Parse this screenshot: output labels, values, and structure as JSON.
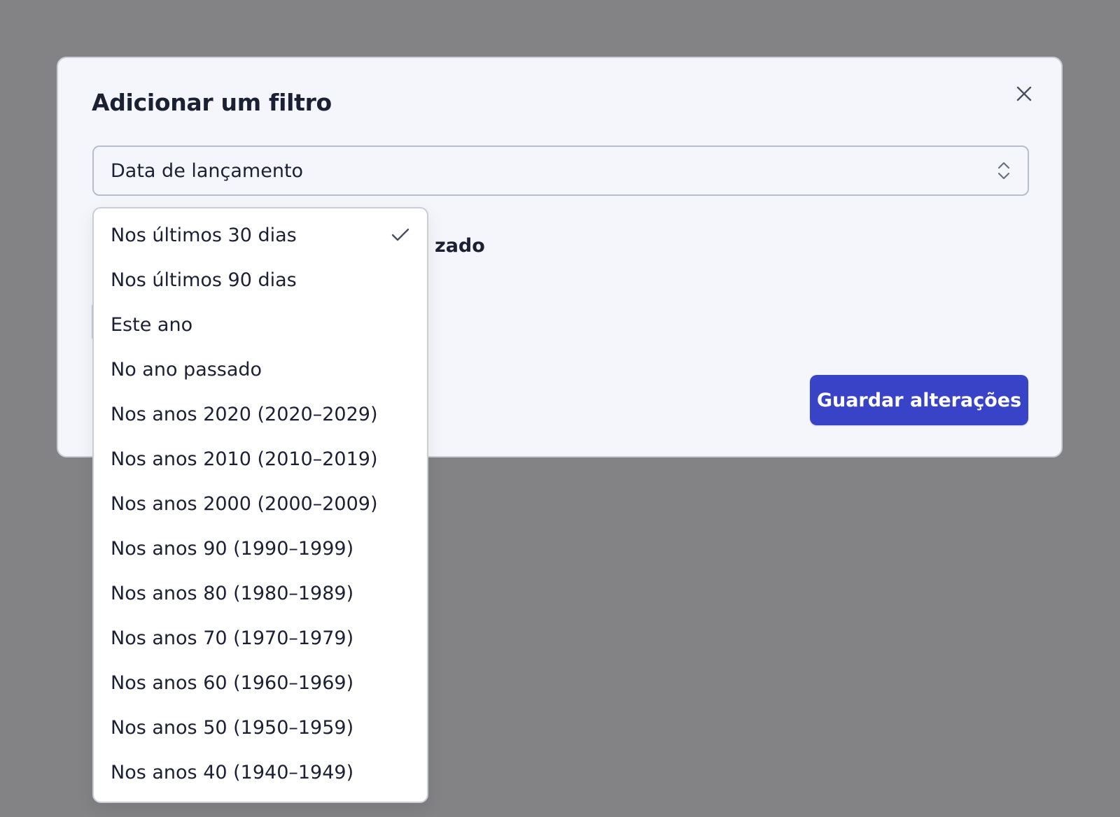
{
  "modal": {
    "title": "Adicionar um filtro",
    "close_icon": "close-icon",
    "select": {
      "value": "Data de lançamento",
      "icon": "chevron-up-down-icon"
    },
    "radio_label_visible": "zado",
    "save_label": "Guardar alterações"
  },
  "dropdown": {
    "selected_index": 0,
    "check_icon": "check-icon",
    "options": [
      "Nos últimos 30 dias",
      "Nos últimos 90 dias",
      "Este ano",
      "No ano passado",
      "Nos anos 2020 (2020–2029)",
      "Nos anos 2010 (2010–2019)",
      "Nos anos 2000 (2000–2009)",
      "Nos anos 90 (1990–1999)",
      "Nos anos 80 (1980–1989)",
      "Nos anos 70 (1970–1979)",
      "Nos anos 60 (1960–1969)",
      "Nos anos 50 (1950–1959)",
      "Nos anos 40 (1940–1949)"
    ]
  },
  "colors": {
    "overlay": "#838386",
    "modal_bg": "#f4f6fb",
    "primary_button": "#3843c8",
    "text": "#1c2033"
  }
}
